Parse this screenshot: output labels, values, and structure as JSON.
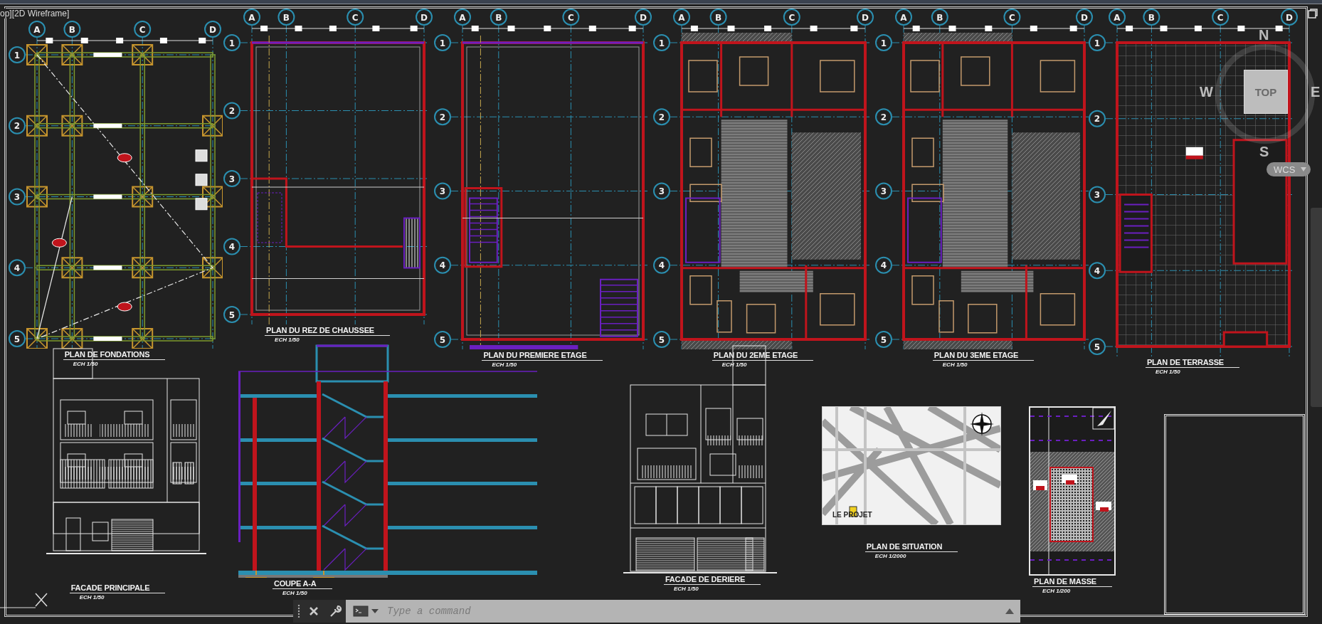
{
  "viewport": {
    "label": "op][2D Wireframe]"
  },
  "plans": [
    {
      "kind": "foundation",
      "columns": [
        "A",
        "B",
        "C",
        "D"
      ],
      "rows": [
        "1",
        "2",
        "3",
        "4",
        "5"
      ],
      "title": "PLAN DE FONDATIONS",
      "scale": "ECH 1/50"
    },
    {
      "kind": "ground",
      "columns": [
        "A",
        "B",
        "C",
        "D"
      ],
      "rows": [
        "1",
        "2",
        "3",
        "4",
        "5"
      ],
      "title": "PLAN DU REZ DE CHAUSSEE",
      "scale": "ECH 1/50"
    },
    {
      "kind": "floor",
      "columns": [
        "A",
        "B",
        "C",
        "D"
      ],
      "rows": [
        "1",
        "2",
        "3",
        "4",
        "5"
      ],
      "title": "PLAN DU PREMIERE ETAGE",
      "scale": "ECH 1/50"
    },
    {
      "kind": "apartment",
      "columns": [
        "A",
        "B",
        "C",
        "D"
      ],
      "rows": [
        "1",
        "2",
        "3",
        "4",
        "5"
      ],
      "title": "PLAN DU 2EME ETAGE",
      "scale": "ECH 1/50"
    },
    {
      "kind": "apartment",
      "columns": [
        "A",
        "B",
        "C",
        "D"
      ],
      "rows": [
        "1",
        "2",
        "3",
        "4",
        "5"
      ],
      "title": "PLAN DU 3EME ETAGE",
      "scale": "ECH 1/50"
    },
    {
      "kind": "roof",
      "columns": [
        "A",
        "B",
        "C",
        "D"
      ],
      "rows": [
        "1",
        "2",
        "3",
        "4",
        "5"
      ],
      "title": "PLAN DE TERRASSE",
      "scale": "ECH 1/50"
    }
  ],
  "elevations": [
    {
      "kind": "facade-front",
      "title": "FACADE PRINCIPALE",
      "scale": "ECH 1/50"
    },
    {
      "kind": "section",
      "title": "COUPE A-A",
      "scale": "ECH 1/50"
    },
    {
      "kind": "facade-rear",
      "title": "FACADE DE DERIERE",
      "scale": "ECH 1/50"
    }
  ],
  "situation": {
    "label": "LE PROJET",
    "title": "PLAN DE SITUATION",
    "scale": "ECH 1/2000"
  },
  "masse": {
    "title": "PLAN DE MASSE",
    "scale": "ECH 1/200"
  },
  "viewcube": {
    "north": "N",
    "west": "W",
    "east": "E",
    "south": "S",
    "face": "TOP",
    "ucs": "WCS"
  },
  "command_line": {
    "placeholder": "Type a command"
  }
}
